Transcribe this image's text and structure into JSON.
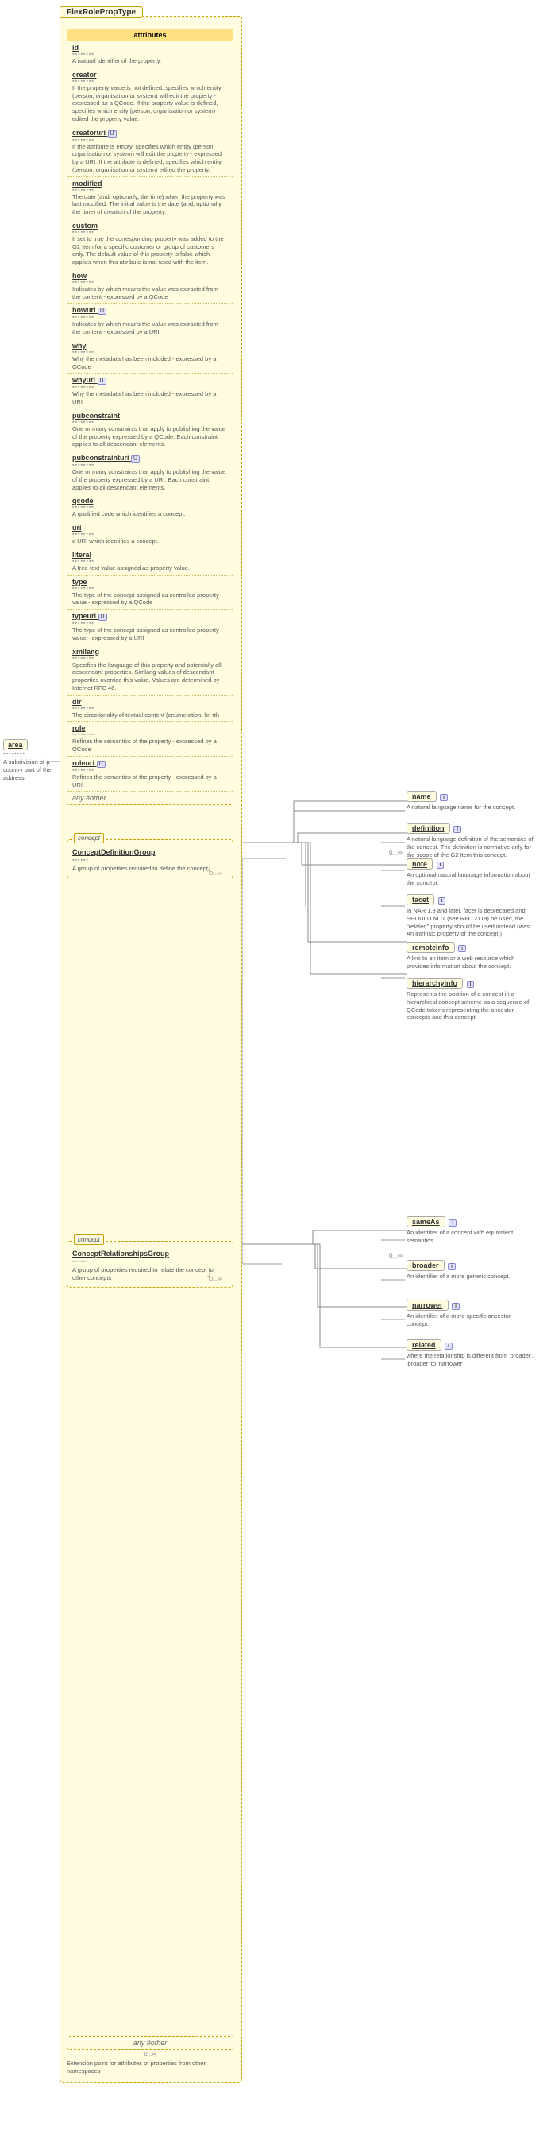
{
  "diagram": {
    "title": "FlexRolePropType",
    "attributes_label": "attributes",
    "attributes": [
      {
        "name": "id",
        "dots": "▪▪▪▪▪▪▪▪",
        "desc": "A natural identifier of the property."
      },
      {
        "name": "creator",
        "dots": "▪▪▪▪▪▪▪▪",
        "desc": "If the property value is not defined, specifies which entity (person, organisation or system) will edit the property - expressed as a QCode. If the property value is defined, specifies which entity (person, organisation or system) edited the property value."
      },
      {
        "name": "creatoruri",
        "dots": "▪▪▪▪▪▪▪▪",
        "desc": "If the attribute is empty, specifies which entity (person, organisation or system) will edit the property - expressed by a URI. If the attribute is defined, specifies which entity (person, organisation or system) edited the property."
      },
      {
        "name": "modified",
        "dots": "▪▪▪▪▪▪▪▪",
        "desc": "The date (and, optionally, the time) when the property was last modified. The initial value is the date (and, optionally, the time) of creation of the property."
      },
      {
        "name": "custom",
        "dots": "▪▪▪▪▪▪▪▪",
        "desc": "If set to true the corresponding property was added to the G2 Item for a specific customer or group of customers only. The default value of this property is false which applies when this attribute is not used with the item."
      },
      {
        "name": "how",
        "dots": "▪▪▪▪▪▪▪▪",
        "desc": "Indicates by which means the value was extracted from the content - expressed by a QCode"
      },
      {
        "name": "howuri",
        "dots": "▪▪▪▪▪▪▪▪",
        "desc": "Indicates by which means the value was extracted from the content - expressed by a URI"
      },
      {
        "name": "why",
        "dots": "▪▪▪▪▪▪▪▪",
        "desc": "Why the metadata has been included - expressed by a QCode"
      },
      {
        "name": "whyuri",
        "dots": "▪▪▪▪▪▪▪▪",
        "desc": "Why the metadata has been included - expressed by a URI"
      },
      {
        "name": "pubconstraint",
        "dots": "▪▪▪▪▪▪▪▪",
        "desc": "One or many constraints that apply to publishing the value of the property expressed by a QCode. Each constraint applies to all descendant elements."
      },
      {
        "name": "pubconstrainturi",
        "dots": "▪▪▪▪▪▪▪▪",
        "desc": "One or many constraints that apply to publishing the value of the property expressed by a URI. Each constraint applies to all descendant elements."
      },
      {
        "name": "qcode",
        "dots": "▪▪▪▪▪▪▪▪",
        "desc": "A qualified code which identifies a concept."
      },
      {
        "name": "uri",
        "dots": "▪▪▪▪▪▪▪▪",
        "desc": "a URI which identifies a concept."
      },
      {
        "name": "literal",
        "dots": "▪▪▪▪▪▪▪▪",
        "desc": "A free-text value assigned as property value."
      },
      {
        "name": "type",
        "dots": "▪▪▪▪▪▪▪▪",
        "desc": "The type of the concept assigned as controlled property value - expressed by a QCode"
      },
      {
        "name": "typeuri",
        "dots": "▪▪▪▪▪▪▪▪",
        "desc": "The type of the concept assigned as controlled property value - expressed by a URI"
      },
      {
        "name": "xmllang",
        "dots": "▪▪▪▪▪▪▪▪",
        "desc": "Specifies the language of this property and potentially all descendant properties. Simlang values of descendant properties override this value. Values are determined by Internet RFC 46."
      },
      {
        "name": "dir",
        "dots": "▪▪▪▪▪▪▪▪",
        "desc": "The directionality of textual content (enumeration: ltr, rtl)"
      },
      {
        "name": "role",
        "dots": "▪▪▪▪▪▪▪▪",
        "desc": "Refines the semantics of the property - expressed by a QCode"
      },
      {
        "name": "roleuri",
        "dots": "▪▪▪▪▪▪▪▪",
        "desc": "Refines the semantics of the property - expressed by a URI"
      },
      {
        "name": "any #other",
        "dots": "",
        "desc": ""
      }
    ],
    "concept_definition_group": {
      "label": "ConceptDefinitionGroup",
      "desc": "A group of properties required to define the concept",
      "cardinality": "0...∞"
    },
    "concept_relationships_group": {
      "label": "ConceptRelationshipsGroup",
      "desc": "A group of properties required to relate the concept to other concepts",
      "cardinality": "0...∞"
    },
    "right_props": [
      {
        "name": "name",
        "uri_badge": "",
        "desc": "A natural language name for the concept.",
        "cardinality": ""
      },
      {
        "name": "definition",
        "uri_badge": "",
        "desc": "A natural language definition of the semantics of the concept. The definition is normative only for the scope of the G2 Item this concept.",
        "cardinality": ""
      },
      {
        "name": "note",
        "uri_badge": "",
        "desc": "An optional natural language information about the concept.",
        "cardinality": ""
      },
      {
        "name": "facet",
        "uri_badge": "",
        "desc": "In NAR 1.8 and later, facet is deprecated and SHOULD NOT (see RFC 2119) be used, the 'related' property should be used instead (was: An intrinsic property of the concept.)",
        "cardinality": ""
      },
      {
        "name": "remoteInfo",
        "uri_badge": "",
        "desc": "A link to an item or a web resource which provides information about the concept.",
        "cardinality": ""
      },
      {
        "name": "hierarchyInfo",
        "uri_badge": "",
        "desc": "Represents the position of a concept in a hierarchical concept scheme as a sequence of QCode tokens representing the ancestor concepts and this concept.",
        "cardinality": ""
      },
      {
        "name": "sameAs",
        "uri_badge": "",
        "desc": "An identifier of a concept with equivalent semantics.",
        "cardinality": ""
      },
      {
        "name": "broader",
        "uri_badge": "",
        "desc": "An identifier of a more generic concept.",
        "cardinality": ""
      },
      {
        "name": "narrower",
        "uri_badge": "",
        "desc": "An identifier of a more specific ancestor concept.",
        "cardinality": ""
      },
      {
        "name": "related",
        "uri_badge": "",
        "desc": "where the relationship is different from 'broader', 'broader' to 'narrower'.",
        "cardinality": ""
      }
    ],
    "bottom_any_other": {
      "label": "any #other",
      "desc": "Extension point for attributes of properties from other namespaces",
      "cardinality": "0...∞"
    },
    "area": {
      "name": "area",
      "dots": "▪▪▪▪▪▪▪▪",
      "desc": "A subdivision of a country part of the address."
    }
  }
}
